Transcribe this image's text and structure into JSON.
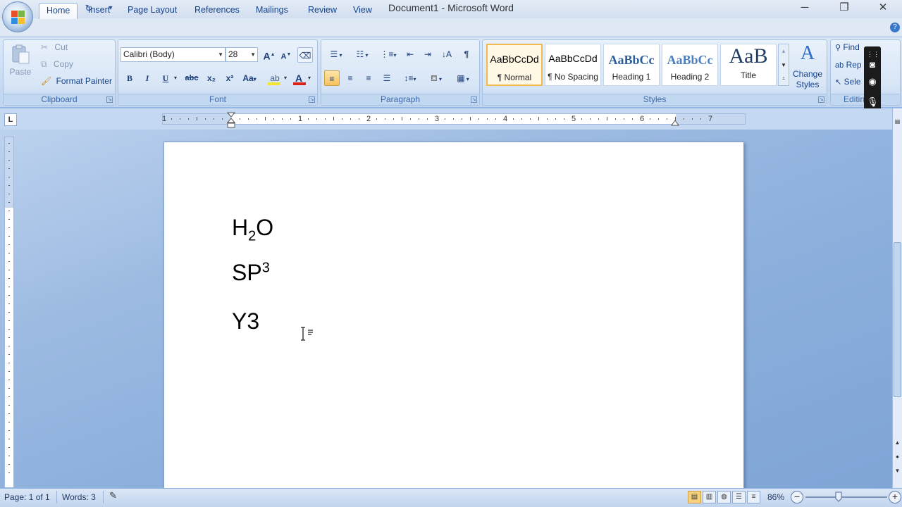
{
  "window": {
    "title": "Document1 - Microsoft Word"
  },
  "quick_access": {
    "customize_label": "▾"
  },
  "tabs": [
    {
      "label": "Home",
      "active": true
    },
    {
      "label": "Insert"
    },
    {
      "label": "Page Layout"
    },
    {
      "label": "References"
    },
    {
      "label": "Mailings"
    },
    {
      "label": "Review"
    },
    {
      "label": "View"
    }
  ],
  "clipboard": {
    "label": "Clipboard",
    "paste": "Paste",
    "cut": "Cut",
    "copy": "Copy",
    "format_painter": "Format Painter"
  },
  "font": {
    "label": "Font",
    "name": "Calibri (Body)",
    "size": "28",
    "bold": "B",
    "italic": "I",
    "underline": "U",
    "strike": "abc",
    "subscript": "x₂",
    "superscript": "x²",
    "change_case": "Aa",
    "grow": "A",
    "shrink": "A",
    "font_color": "A"
  },
  "paragraph": {
    "label": "Paragraph"
  },
  "styles": {
    "label": "Styles",
    "items": [
      {
        "sample": "AaBbCcDd",
        "name": "¶ Normal",
        "selected": true
      },
      {
        "sample": "AaBbCcDd",
        "name": "¶ No Spacing"
      },
      {
        "sample": "AaBbCc",
        "name": "Heading 1"
      },
      {
        "sample": "AaBbCc",
        "name": "Heading 2"
      },
      {
        "sample": "AaB",
        "name": "Title"
      }
    ],
    "change_styles": "Change Styles"
  },
  "editing": {
    "label": "Editing",
    "find": "Find",
    "replace": "Rep",
    "select": "Sele"
  },
  "ruler": {
    "numbers": [
      "1",
      "1",
      "2",
      "3",
      "4",
      "5",
      "6",
      "7"
    ],
    "tab_selector": "L"
  },
  "document": {
    "line1": {
      "base": "H",
      "sub": "2",
      "rest": "O"
    },
    "line2": {
      "base": "SP",
      "sup": "3"
    },
    "line3": {
      "text": "Y3"
    }
  },
  "status": {
    "page": "Page: 1 of 1",
    "words": "Words: 3",
    "zoom": "86%"
  },
  "colors": {
    "accent": "#15428b",
    "ribbon": "#c9dbf1",
    "font_color_bar": "#e0201b",
    "highlight_bar": "#f6e62b"
  }
}
